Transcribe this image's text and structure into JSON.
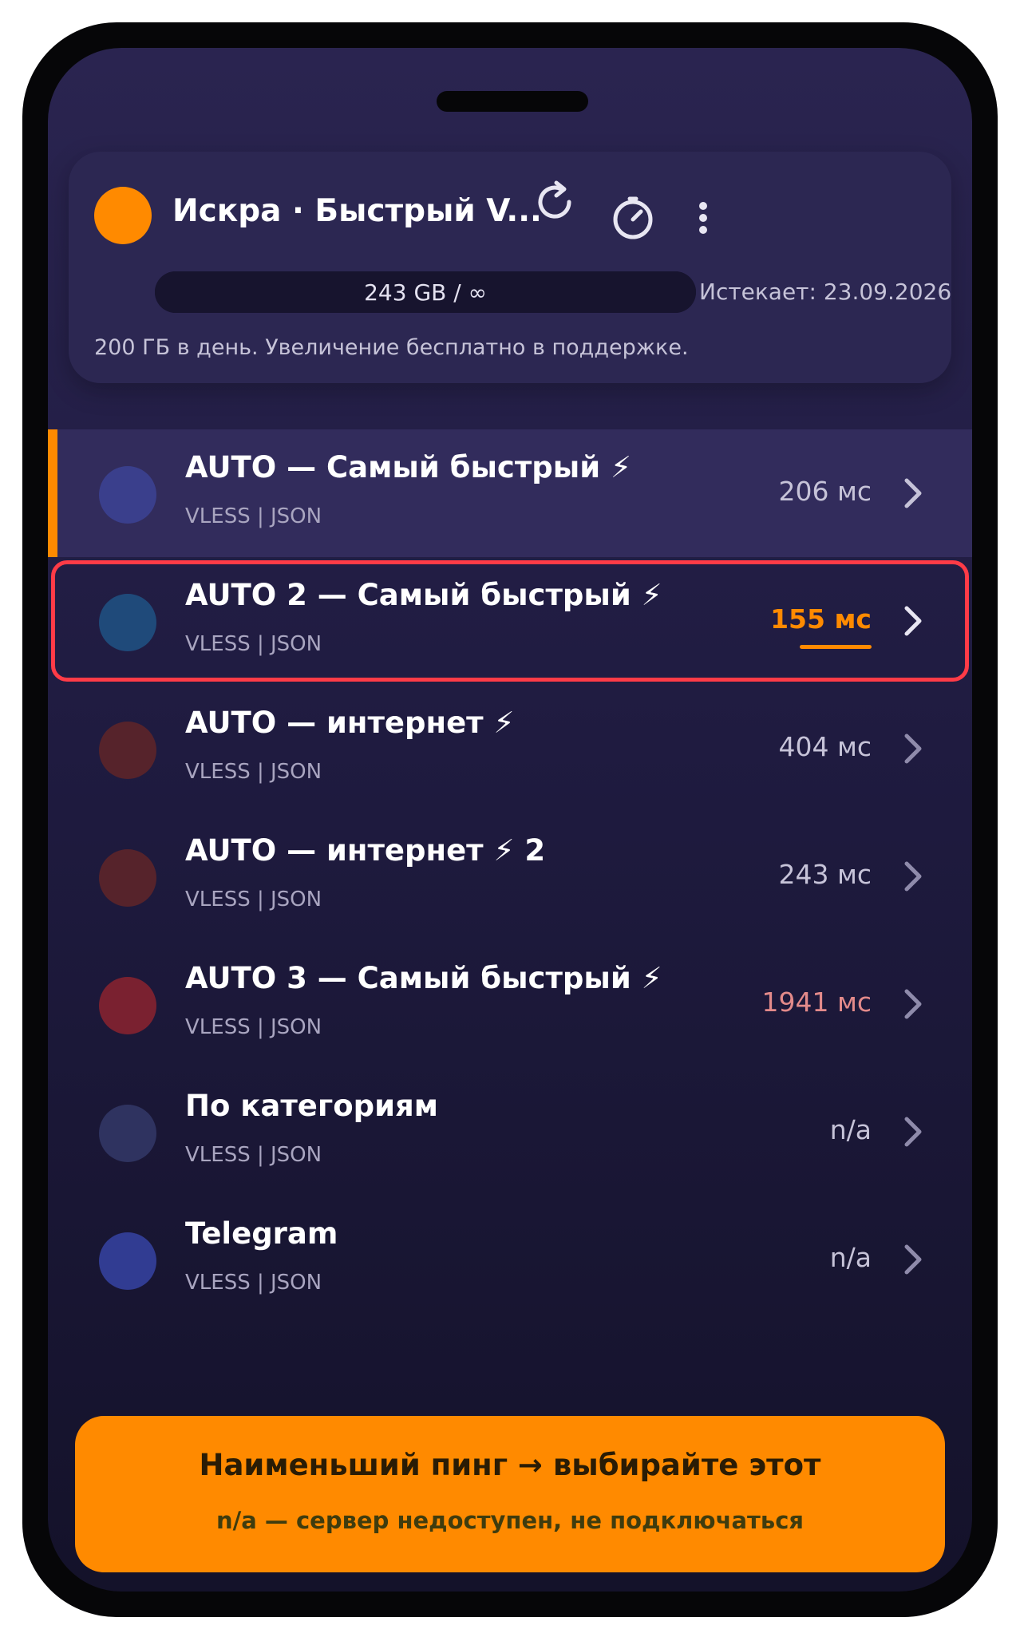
{
  "header": {
    "app_title": "Искра · Быстрый V...",
    "traffic_usage": "243 GB / ∞",
    "expires": "Истекает: 23.09.2026",
    "note": "200 ГБ в день. Увеличение бесплатно в поддержке."
  },
  "icons": {
    "refresh": "refresh-icon",
    "speedtest": "speedometer-icon",
    "menu": "more-vertical-icon"
  },
  "servers": [
    {
      "name": "AUTO — Самый быстрый ⚡",
      "sub": "VLESS | JSON",
      "ping": "206 мс",
      "dot_color": "#3a3f8c",
      "ping_color": "#c6c3d8",
      "active": true
    },
    {
      "name": "AUTO 2 — Самый быстрый ⚡",
      "sub": "VLESS | JSON",
      "ping": "155 мс",
      "dot_color": "#1f4a7a",
      "ping_color": "#ff8a00",
      "best": true
    },
    {
      "name": "AUTO — интернет ⚡",
      "sub": "VLESS | JSON",
      "ping": "404 мс",
      "dot_color": "#56232b",
      "ping_color": "#c6c3d8"
    },
    {
      "name": "AUTO — интернет ⚡ 2",
      "sub": "VLESS | JSON",
      "ping": "243 мс",
      "dot_color": "#56232b",
      "ping_color": "#c6c3d8"
    },
    {
      "name": "AUTO 3 — Самый быстрый ⚡",
      "sub": "VLESS | JSON",
      "ping": "1941 мс",
      "dot_color": "#7a2130",
      "ping_color": "#e38a8a"
    },
    {
      "name": "По категориям",
      "sub": "VLESS | JSON",
      "ping": "n/a",
      "dot_color": "#2f3360",
      "ping_color": "#c6c3d8"
    },
    {
      "name": "Telegram",
      "sub": "VLESS | JSON",
      "ping": "n/a",
      "dot_color": "#313c92",
      "ping_color": "#c6c3d8"
    }
  ],
  "banner": {
    "title": "Наименьший пинг → выбирайте этот",
    "subtitle": "n/a — сервер недоступен, не подключаться"
  }
}
